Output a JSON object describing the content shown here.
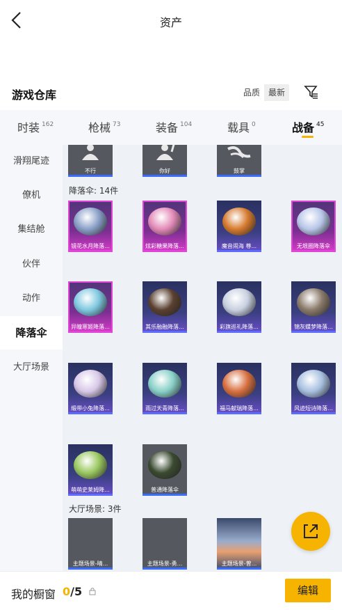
{
  "header": {
    "title": "资产"
  },
  "repository": {
    "title": "游戏仓库",
    "sort_quality": "品质",
    "sort_newest": "最新"
  },
  "tabs": [
    {
      "label": "时装",
      "count": "162"
    },
    {
      "label": "枪械",
      "count": "73"
    },
    {
      "label": "装备",
      "count": "104"
    },
    {
      "label": "载具",
      "count": "0"
    },
    {
      "label": "战备",
      "count": "45",
      "active": true
    }
  ],
  "sidebar": {
    "items": [
      {
        "label": "滑翔尾迹"
      },
      {
        "label": "僚机"
      },
      {
        "label": "集结舱"
      },
      {
        "label": "伙伴"
      },
      {
        "label": "动作"
      },
      {
        "label": "降落伞",
        "active": true
      },
      {
        "label": "大厅场景"
      }
    ]
  },
  "emotes": {
    "items": [
      {
        "name": "不行",
        "icon": "emote-refuse-icon"
      },
      {
        "name": "你好",
        "icon": "emote-hello-icon"
      },
      {
        "name": "鼓掌",
        "icon": "emote-clap-icon"
      }
    ]
  },
  "parachutes": {
    "label": "降落伞: 14件",
    "items": [
      {
        "name": "镜花水月降落...",
        "rarity": "pink",
        "color": "#8aa0c8"
      },
      {
        "name": "炫彩糖果降落...",
        "rarity": "pink",
        "color": "#e38ab8"
      },
      {
        "name": "魔音闹海 尊...",
        "rarity": "purple",
        "color": "#d67a2e"
      },
      {
        "name": "无垠圈降落伞",
        "rarity": "pink",
        "color": "#b8c6e8"
      },
      {
        "name": "异瞳寒姬降落...",
        "rarity": "pink",
        "color": "#7ec8e0"
      },
      {
        "name": "其乐融融降落...",
        "rarity": "purple",
        "color": "#5a4030"
      },
      {
        "name": "彩旗巡礼降落...",
        "rarity": "purple",
        "color": "#c8d0e0"
      },
      {
        "name": "锦灰蝶梦降落...",
        "rarity": "purple",
        "color": "#8a7a6a"
      },
      {
        "name": "缎带小兔降落...",
        "rarity": "purple",
        "color": "#d8c8e8"
      },
      {
        "name": "雨过天青降落...",
        "rarity": "purple",
        "color": "#88d0c8"
      },
      {
        "name": "福马献瑞降落...",
        "rarity": "purple",
        "color": "#d87040"
      },
      {
        "name": "风迹短诗降落...",
        "rarity": "purple",
        "color": "#a8c0e0"
      },
      {
        "name": "萌萌史莱姆降...",
        "rarity": "purple",
        "color": "#9ac860"
      },
      {
        "name": "普通降落伞",
        "rarity": "gray",
        "color": "#3a4a30"
      }
    ]
  },
  "lobby": {
    "label": "大厅场景: 3件",
    "items": [
      {
        "name": "主题场景-晴..."
      },
      {
        "name": "主题场景-勇..."
      },
      {
        "name": "主题场景-曾..."
      }
    ]
  },
  "bottom": {
    "showcase_label": "我的橱窗",
    "showcase_current": "0",
    "showcase_total": "/5",
    "edit_label": "编辑"
  },
  "colors": {
    "accent": "#f6b300",
    "purple_rarity": "#5b6cff",
    "pink_rarity": "#e045d8"
  }
}
